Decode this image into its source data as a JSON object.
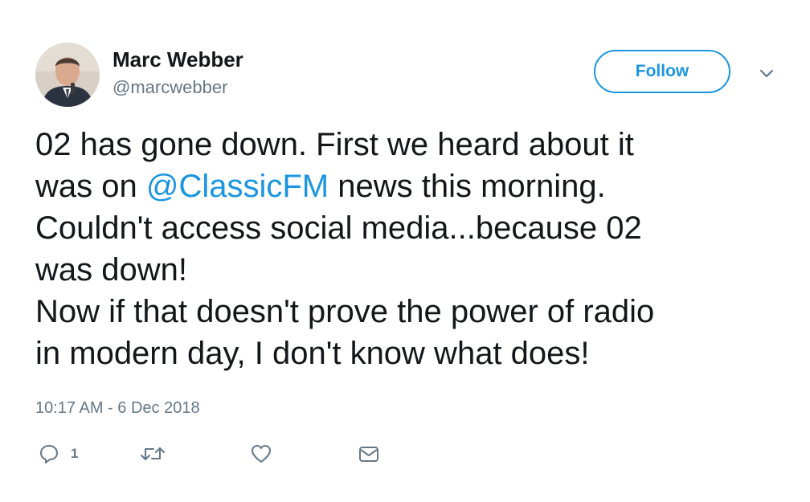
{
  "tweet": {
    "author": {
      "display_name": "Marc Webber",
      "handle": "@marcwebber",
      "avatar_icon": "user-avatar-photo"
    },
    "follow_label": "Follow",
    "more_icon": "chevron-down-icon",
    "text": {
      "line1": "02 has gone down. First we heard about it",
      "line2_before": "was on ",
      "line2_mention": "@ClassicFM",
      "line2_after": " news this morning.",
      "line3": "Couldn't access social media...because 02",
      "line4": "was down!",
      "line5": "Now if that doesn't prove the power of radio",
      "line6": "in modern day, I don't know what does!"
    },
    "timestamp": "10:17 AM - 6 Dec 2018",
    "actions": {
      "reply_icon": "reply-icon",
      "reply_count": "1",
      "retweet_icon": "retweet-icon",
      "like_icon": "heart-icon",
      "dm_icon": "envelope-icon"
    },
    "colors": {
      "accent": "#1b95e0",
      "text": "#14171a",
      "secondary": "#657786"
    }
  }
}
